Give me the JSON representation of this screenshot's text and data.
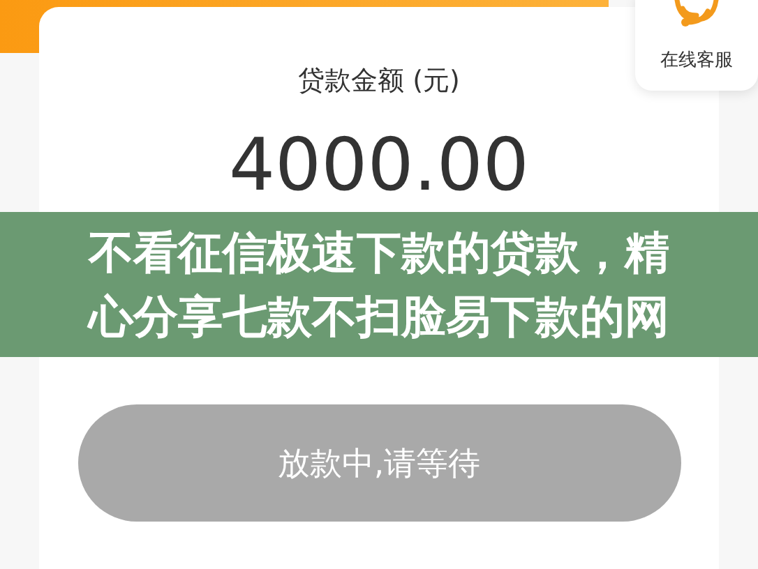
{
  "service_button": {
    "label": "在线客服"
  },
  "loan": {
    "label": "贷款金额 (元)",
    "amount": "4000.00"
  },
  "submit_button": {
    "label": "放款中,请等待",
    "disabled": true
  },
  "caption": {
    "lines": [
      "不看征信极速下款的贷款，精",
      "心分享七款不扫脸易下款的网"
    ]
  }
}
